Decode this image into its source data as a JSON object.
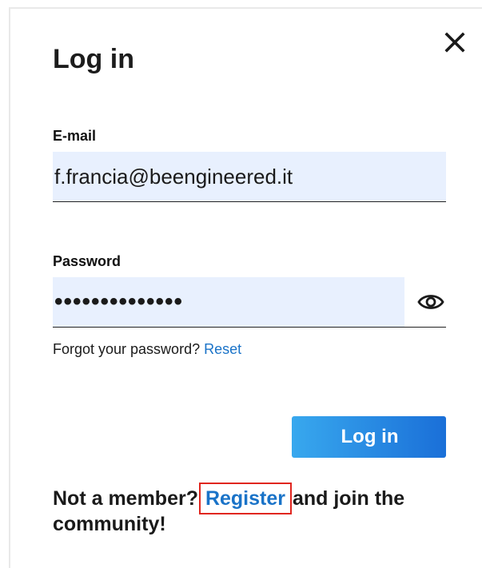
{
  "dialog": {
    "title": "Log in",
    "close_icon": "close-icon"
  },
  "email": {
    "label": "E-mail",
    "value": "f.francia@beengineered.it"
  },
  "password": {
    "label": "Password",
    "masked_value": "••••••••••••••",
    "toggle_icon": "eye-icon"
  },
  "forgot": {
    "prefix": "Forgot your password?",
    "link_label": "Reset"
  },
  "login_button": {
    "label": "Log in"
  },
  "register": {
    "prefix": "Not a member?",
    "link_label": "Register",
    "suffix": "and join the community!"
  },
  "colors": {
    "link": "#1a73c8",
    "input_autofill_bg": "#e8f0fe",
    "button_gradient_start": "#38a8ee",
    "button_gradient_end": "#1a6fd8",
    "highlight_box": "#e0261f"
  }
}
